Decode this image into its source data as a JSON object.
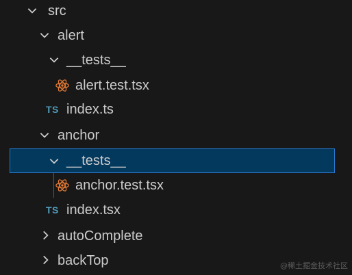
{
  "explorer": {
    "items": [
      {
        "label": "src",
        "kind": "folder",
        "expanded": true,
        "icon": "chevron-down-icon"
      },
      {
        "label": "alert",
        "kind": "folder",
        "expanded": true,
        "icon": "chevron-down-icon"
      },
      {
        "label": "__tests__",
        "kind": "folder",
        "expanded": true,
        "icon": "chevron-down-icon"
      },
      {
        "label": "alert.test.tsx",
        "kind": "file",
        "icon": "react-icon"
      },
      {
        "label": "index.ts",
        "kind": "file",
        "icon": "typescript-icon",
        "icon_text": "TS"
      },
      {
        "label": "anchor",
        "kind": "folder",
        "expanded": true,
        "icon": "chevron-down-icon"
      },
      {
        "label": "__tests__",
        "kind": "folder",
        "expanded": true,
        "selected": true,
        "icon": "chevron-down-icon"
      },
      {
        "label": "anchor.test.tsx",
        "kind": "file",
        "icon": "react-icon"
      },
      {
        "label": "index.tsx",
        "kind": "file",
        "icon": "typescript-icon",
        "icon_text": "TS"
      },
      {
        "label": "autoComplete",
        "kind": "folder",
        "expanded": false,
        "icon": "chevron-right-icon"
      },
      {
        "label": "backTop",
        "kind": "folder",
        "expanded": false,
        "icon": "chevron-right-icon"
      }
    ]
  },
  "colors": {
    "background": "#181818",
    "text": "#cccccc",
    "selection_bg": "#04395e",
    "selection_border": "#2b79d0",
    "ts_icon": "#519aba",
    "react_icon": "#e37933"
  },
  "watermark": "@稀土掘金技术社区"
}
